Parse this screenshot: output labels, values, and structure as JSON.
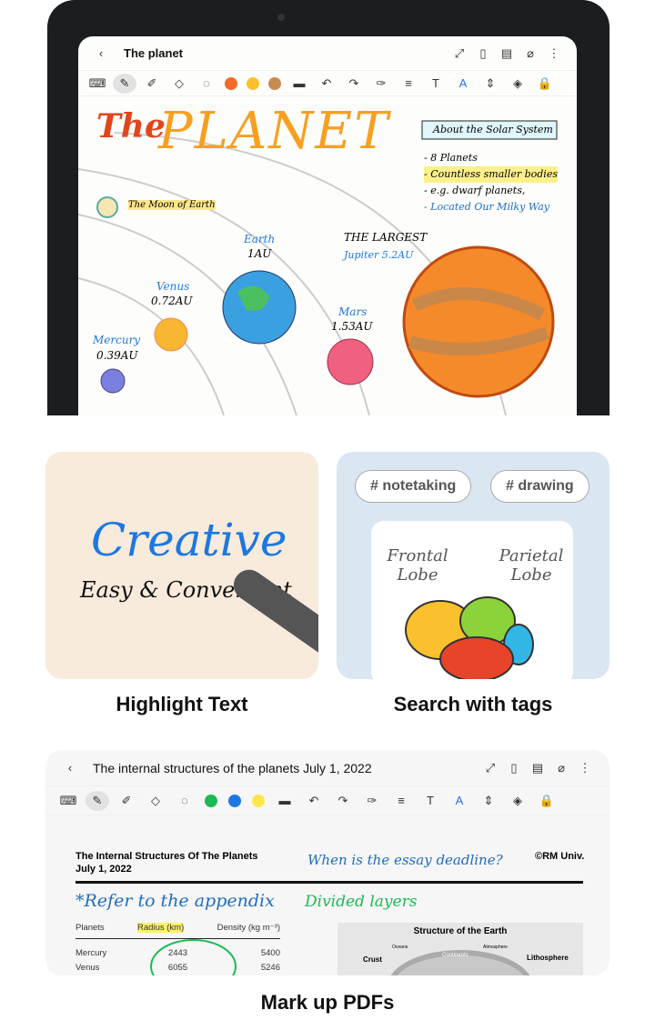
{
  "note1": {
    "title": "The planet",
    "colors": [
      "#f26b2a",
      "#fbc02d",
      "#c98a52"
    ]
  },
  "drawing": {
    "heading1": "The",
    "heading2": "PLANET",
    "moon": "The Moon of Earth",
    "box_title": "About the Solar System",
    "bullets": [
      "- 8 Planets",
      "- Countless smaller bodies",
      "- e.g. dwarf planets,",
      "- Located Our Milky Way"
    ],
    "earth": "Earth",
    "earth_au": "1AU",
    "venus": "Venus",
    "venus_au": "0.72AU",
    "mercury": "Mercury",
    "mercury_au": "0.39AU",
    "mars": "Mars",
    "mars_au": "1.53AU",
    "largest": "THE LARGEST",
    "jupiter": "Jupiter 5.2AU"
  },
  "features": [
    {
      "label": "Highlight Text",
      "word1": "Creative",
      "word2": "Easy & Convenient"
    },
    {
      "label": "Search with tags",
      "tags": [
        "# notetaking",
        "# drawing"
      ],
      "frontal": "Frontal Lobe",
      "parietal": "Parietal Lobe"
    },
    {
      "label": "Mark up PDFs"
    }
  ],
  "note2": {
    "title": "The internal structures of the planets July 1, 2022",
    "colors": [
      "#1db954",
      "#1e78e0",
      "#fde74c"
    ],
    "doc_title": "The Internal Structures Of The Planets",
    "doc_date": "July 1, 2022",
    "note_q": "When is the essay deadline?",
    "copyright": "©RM Univ.",
    "note_ref": "*Refer to the appendix",
    "note_layers": "Divided layers",
    "table": {
      "headers": [
        "Planets",
        "Radius (km)",
        "Density (kg m⁻³)"
      ],
      "rows": [
        [
          "Mercury",
          "2443",
          "5400"
        ],
        [
          "Venus",
          "6055",
          "5246"
        ]
      ]
    },
    "figure": {
      "title": "Structure of the Earth",
      "labels": [
        "Oceans",
        "Atmosphere",
        "Continents",
        "Crust",
        "Lithosphere"
      ]
    }
  }
}
